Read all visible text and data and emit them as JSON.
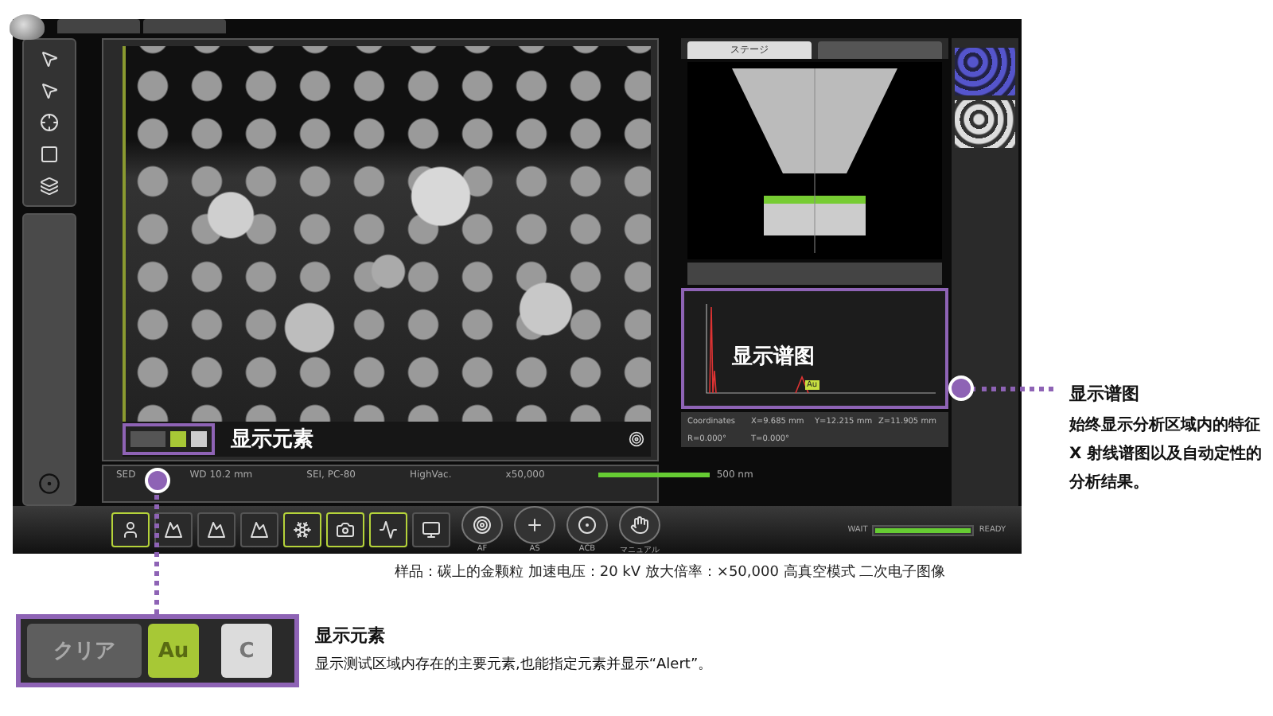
{
  "image_panel": {
    "callout_label": "显示元素"
  },
  "status_bar": {
    "items": [
      "SED",
      "WD 10.2 mm",
      "SEI, PC-80",
      "HighVac.",
      "x50,000"
    ],
    "scale": "500 nm"
  },
  "toolbar": [
    {
      "kind": "user",
      "on": true
    },
    {
      "kind": "stage",
      "on": false
    },
    {
      "kind": "stage",
      "on": false
    },
    {
      "kind": "stage",
      "on": false
    },
    {
      "kind": "snow",
      "on": true
    },
    {
      "kind": "camera",
      "on": true
    },
    {
      "kind": "chart",
      "on": true
    },
    {
      "kind": "monitor",
      "on": false
    }
  ],
  "round_buttons": [
    {
      "label": "AF",
      "kind": "target"
    },
    {
      "label": "AS",
      "kind": "plus"
    },
    {
      "label": "ACB",
      "kind": "contrast"
    },
    {
      "label": "マニュアル",
      "kind": "hand"
    }
  ],
  "stage_tabs": [
    {
      "label": "ステージ",
      "selected": true
    },
    {
      "selected": false
    }
  ],
  "spectrum": {
    "callout_label": "显示谱图",
    "peak_label": "Au"
  },
  "coordinates": {
    "label": "Coordinates",
    "values": [
      "X=9.685 mm",
      "Y=12.215 mm",
      "Z=11.905 mm",
      "R=0.000°",
      "T=0.000°"
    ]
  },
  "vacuum": {
    "left": "WAIT",
    "right": "READY",
    "level": 1
  },
  "spectrum_note": {
    "title": "显示谱图",
    "text": "始终显示分析区域内的特征 X 射线谱图以及自动定性的分析结果。"
  },
  "caption": "样品：碳上的金颗粒 加速电压：20 kV 放大倍率：×50,000 高真空模式 二次电子图像",
  "element_note": {
    "title": "显示元素",
    "text": "显示测试区域内存在的主要元素,也能指定元素并显示“Alert”。"
  },
  "element_buttons": [
    {
      "label": "クリア",
      "kind": "clear",
      "selected": false
    },
    {
      "label": "Au",
      "kind": "element",
      "selected": true
    },
    {
      "label": "C",
      "kind": "element",
      "selected": false
    }
  ]
}
